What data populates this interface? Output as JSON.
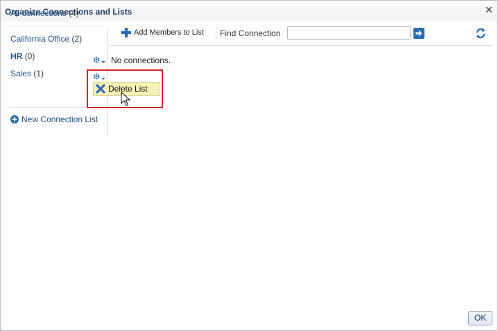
{
  "dialog": {
    "title": "Organize Connections and Lists",
    "close_icon": "close-icon",
    "ok_label": "OK"
  },
  "sidebar": {
    "all_connections": {
      "label": "All connections",
      "count": "(4)"
    },
    "lists": [
      {
        "label": "California Office",
        "count": "(2)",
        "has_gear": true
      },
      {
        "label": "HR",
        "count": "(0)",
        "has_gear": true,
        "selected": true
      },
      {
        "label": "Sales",
        "count": "(1)",
        "has_gear": false
      }
    ],
    "new_list_label": "New Connection List",
    "new_list_icon": "plus-circle-icon"
  },
  "toolbar": {
    "add_members_label": "Add Members to List",
    "add_members_icon": "plus-icon",
    "find_label": "Find Connection",
    "find_value": "",
    "go_icon": "arrow-right-icon",
    "refresh_icon": "refresh-icon"
  },
  "content": {
    "empty_message": "No connections."
  },
  "menu": {
    "items": [
      {
        "label": "Delete List",
        "icon": "delete-x-icon"
      }
    ]
  },
  "colors": {
    "link": "#1e4f88",
    "accent": "#2a6db3",
    "menu_bg": "#f7f1b8",
    "highlight_border": "#d92026"
  }
}
